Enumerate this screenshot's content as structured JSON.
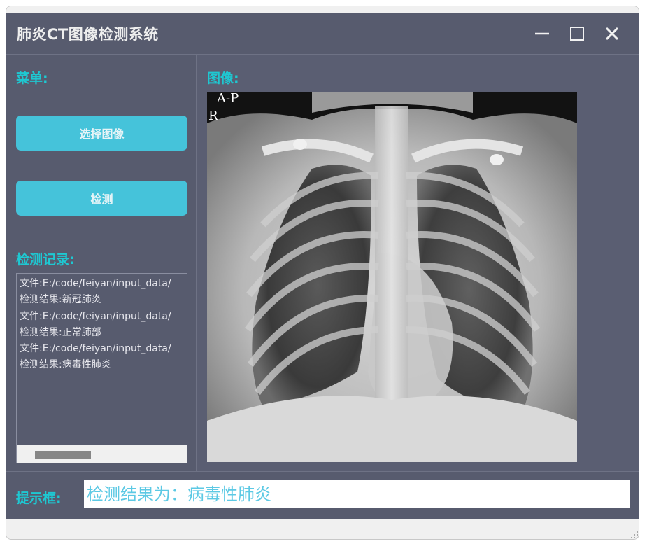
{
  "window": {
    "title": "肺炎CT图像检测系统"
  },
  "menu": {
    "label": "菜单:",
    "select_image_button": "选择图像",
    "detect_button": "检测"
  },
  "records": {
    "label": "检测记录:",
    "lines": [
      "文件:E:/code/feiyan/input_data/",
      "检测结果:新冠肺炎",
      "文件:E:/code/feiyan/input_data/",
      "检测结果:正常肺部",
      "文件:E:/code/feiyan/input_data/",
      "检测结果:病毒性肺炎"
    ]
  },
  "image_panel": {
    "label": "图像:",
    "xray_markers": [
      "A-P",
      "R"
    ]
  },
  "prompt": {
    "label": "提示框:",
    "message": "检测结果为：病毒性肺炎"
  },
  "colors": {
    "accent": "#1ec8d2",
    "button": "#45c3da",
    "panel": "#575b6e",
    "result_text": "#5cc9e4"
  },
  "icons": [
    "minimize-icon",
    "maximize-icon",
    "close-icon",
    "resize-grip-icon"
  ]
}
